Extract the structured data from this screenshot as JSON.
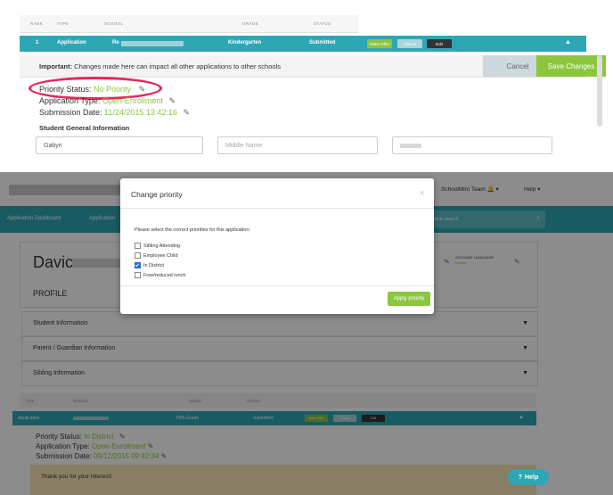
{
  "top": {
    "table_headers": [
      "RANK",
      "TYPE",
      "SCHOOL",
      "GRADE",
      "STATUS"
    ],
    "row": {
      "rank": "1",
      "type": "Application",
      "school": "Re",
      "grade": "Kindergarten",
      "status": "Submitted",
      "make_offer": "Make Offer",
      "cancel": "Cancel",
      "edit": "Edit"
    },
    "important_label": "Important:",
    "important_text": " Changes made here can impact all other applications to other schools",
    "cancel_button": "Cancel",
    "save_button": "Save Changes",
    "priority_label": "Priority Status: ",
    "priority_value": "No Priority",
    "app_type_label": "Application Type: ",
    "app_type_value": "Open-Enrollment",
    "submission_label": "Submission Date: ",
    "submission_value": "11/24/2015 13:42:16",
    "student_info_heading": "Student General Information",
    "first_name_value": "Gabyn",
    "middle_name_placeholder": "Middle Name"
  },
  "bottom": {
    "header_user": "SchoolMint Team",
    "header_help": "Help",
    "nav_dashboard": "Application Dashboard",
    "nav_application": "Application",
    "student_search": "dent search",
    "student_first_name": "Davic",
    "account_language_label": "ACCOUNT LANGUAGE",
    "account_language_value": "English",
    "profile_heading": "PROFILE",
    "sections": [
      "Student Information",
      "Parent / Guardian Information",
      "Sibling Information"
    ],
    "table_headers": [
      "TYPE",
      "SCHOOL",
      "GRADE",
      "STATUS"
    ],
    "row": {
      "type": "Application",
      "grade": "Fifth Grade",
      "status": "Submitted",
      "make_offer": "Make Offer",
      "cancel": "Cancel",
      "edit": "Edit"
    },
    "priority_label": "Priority Status: ",
    "priority_value": "In District",
    "app_type_label": "Application Type: ",
    "app_type_value": "Open-Enrollment",
    "submission_label": "Submission Date: ",
    "submission_value": "09/12/2015 09:42:34",
    "thank_you": "Thank you for your interest!",
    "help_button": "Help"
  },
  "modal": {
    "title": "Change priority",
    "prompt": "Please select the correct priorities for this application:",
    "options": [
      {
        "label": "Sibling Attending",
        "checked": false
      },
      {
        "label": "Employee Child",
        "checked": false
      },
      {
        "label": "In District",
        "checked": true
      },
      {
        "label": "Free/reduced lunch",
        "checked": false
      }
    ],
    "apply_button": "Apply priority"
  },
  "colors": {
    "teal": "#2fa6b4",
    "green": "#8cc63f",
    "highlight_oval": "#e8265e"
  }
}
